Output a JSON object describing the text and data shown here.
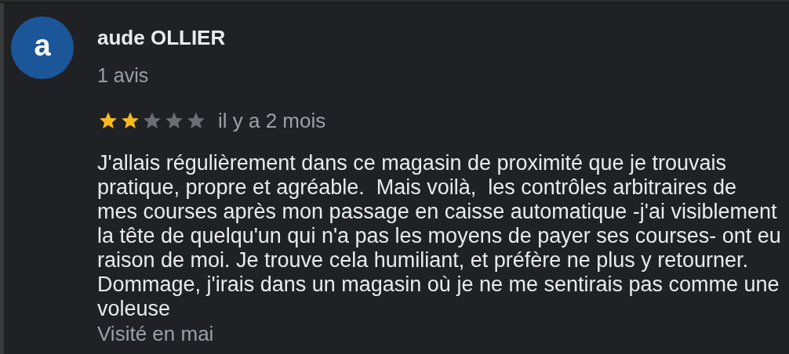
{
  "review": {
    "avatar_letter": "a",
    "author": "aude OLLIER",
    "reviews_count": "1 avis",
    "stars": 2,
    "time": "il y a 2 mois",
    "text": "J'allais régulièrement dans ce magasin de proximité que je trouvais pratique, propre et agréable.  Mais voilà,  les contrôles arbitraires de mes courses après mon passage en caisse automatique -j'ai visiblement la tête de quelqu'un qui n'a pas les moyens de payer ses courses- ont eu raison de moi. Je trouve cela humiliant, et préfère ne plus y retourner. Dommage, j'irais dans un magasin où je ne me sentirais pas comme une voleuse",
    "visited": "Visité en mai"
  }
}
